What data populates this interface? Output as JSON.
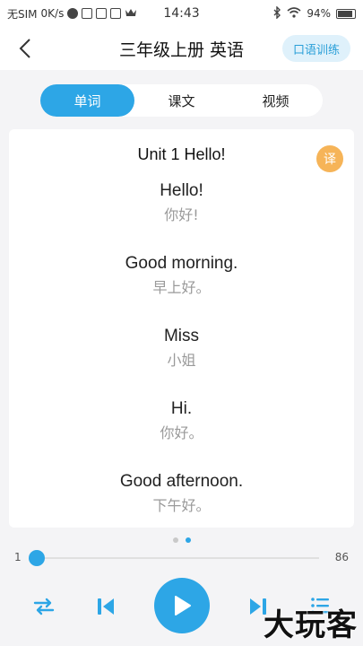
{
  "status_bar": {
    "carrier": "无SIM",
    "speed": "0K/s",
    "time": "14:43",
    "battery": "94%",
    "icons": [
      "moon-icon",
      "s-app-icon",
      "p-app-icon",
      "mail-icon",
      "crown-icon",
      "bluetooth-icon",
      "wifi-icon",
      "battery-icon"
    ]
  },
  "header": {
    "title": "三年级上册 英语",
    "oral_button": "口语训练"
  },
  "tabs": [
    {
      "label": "单词",
      "active": true
    },
    {
      "label": "课文",
      "active": false
    },
    {
      "label": "视频",
      "active": false
    }
  ],
  "card": {
    "unit_title": "Unit 1 Hello!",
    "translate_label": "译",
    "words": [
      {
        "en": "Hello!",
        "cn": "你好!"
      },
      {
        "en": "Good morning.",
        "cn": "早上好。"
      },
      {
        "en": "Miss",
        "cn": "小姐"
      },
      {
        "en": "Hi.",
        "cn": "你好。"
      },
      {
        "en": "Good afternoon.",
        "cn": "下午好。"
      }
    ]
  },
  "pager": {
    "count": 2,
    "active_index": 1
  },
  "progress": {
    "start": "1",
    "end": "86",
    "current": 1
  },
  "player": {
    "icons": [
      "repeat-icon",
      "previous-icon",
      "play-icon",
      "next-icon",
      "playlist-icon"
    ]
  },
  "watermark": "大玩客",
  "colors": {
    "accent": "#2da6e6",
    "translate": "#f6b458",
    "oral_bg": "#dff1fb"
  }
}
